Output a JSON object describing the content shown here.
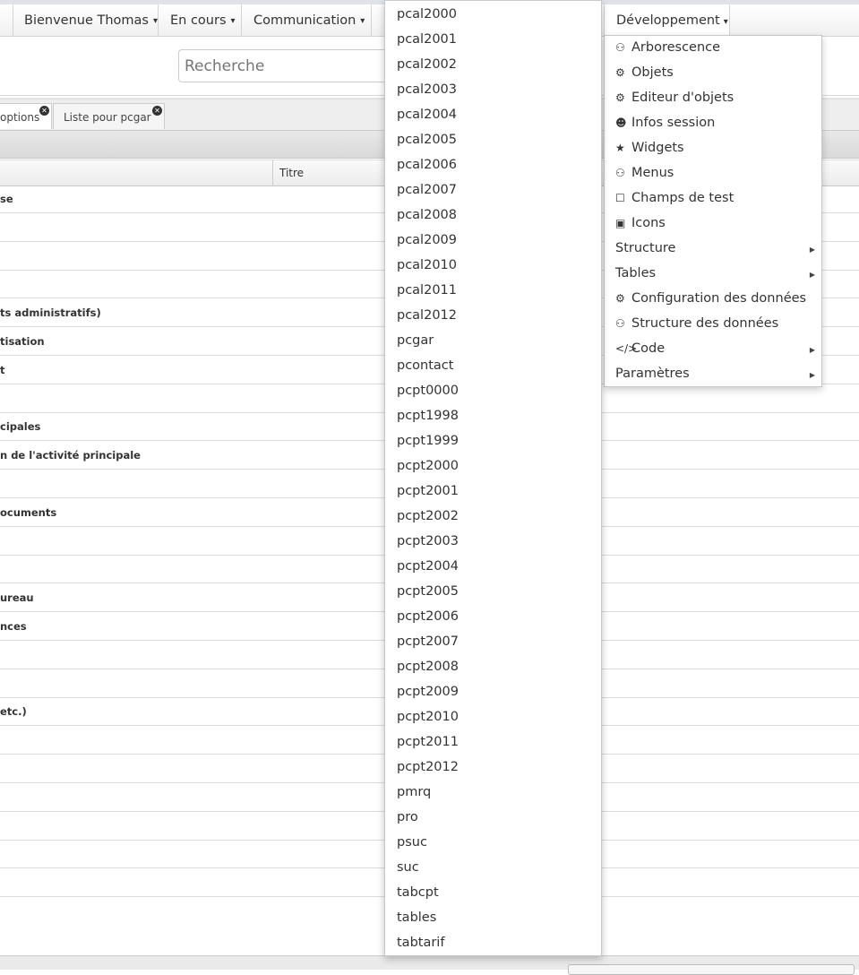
{
  "navbar": {
    "items": [
      {
        "label": "Bienvenue Thomas",
        "caret": "▾"
      },
      {
        "label": "En cours",
        "caret": "▾"
      },
      {
        "label": "Communication",
        "caret": "▾"
      }
    ],
    "dev": {
      "label": "Développement",
      "caret": "▾"
    }
  },
  "search": {
    "placeholder": "Recherche"
  },
  "tabs": [
    {
      "label": "options"
    },
    {
      "label": "Liste pour pcgar"
    }
  ],
  "grid": {
    "col_title": "Titre",
    "rows": [
      "se",
      "",
      "",
      "",
      "ts administratifs)",
      "tisation",
      "t",
      "",
      "cipales",
      "n de l'activité principale",
      "",
      "ocuments",
      "",
      "",
      "ureau",
      "nces",
      "",
      "",
      "etc.)",
      "",
      "",
      "",
      "",
      "",
      ""
    ]
  },
  "table_list": [
    "pcal2000",
    "pcal2001",
    "pcal2002",
    "pcal2003",
    "pcal2004",
    "pcal2005",
    "pcal2006",
    "pcal2007",
    "pcal2008",
    "pcal2009",
    "pcal2010",
    "pcal2011",
    "pcal2012",
    "pcgar",
    "pcontact",
    "pcpt0000",
    "pcpt1998",
    "pcpt1999",
    "pcpt2000",
    "pcpt2001",
    "pcpt2002",
    "pcpt2003",
    "pcpt2004",
    "pcpt2005",
    "pcpt2006",
    "pcpt2007",
    "pcpt2008",
    "pcpt2009",
    "pcpt2010",
    "pcpt2011",
    "pcpt2012",
    "pmrq",
    "pro",
    "psuc",
    "suc",
    "tabcpt",
    "tables",
    "tabtarif"
  ],
  "dev_menu": [
    {
      "label": "Arborescence",
      "icon": "sitemap-icon",
      "glyph": "⚇"
    },
    {
      "label": "Objets",
      "icon": "cogs-icon",
      "glyph": "⚙"
    },
    {
      "label": "Editeur d'objets",
      "icon": "cogs-icon",
      "glyph": "⚙"
    },
    {
      "label": "Infos session",
      "icon": "user-icon",
      "glyph": "☻"
    },
    {
      "label": "Widgets",
      "icon": "star-icon",
      "glyph": "★"
    },
    {
      "label": "Menus",
      "icon": "sitemap-icon",
      "glyph": "⚇"
    },
    {
      "label": "Champs de test",
      "icon": "checkbox-icon",
      "glyph": "☐"
    },
    {
      "label": "Icons",
      "icon": "image-icon",
      "glyph": "▣"
    },
    {
      "label": "Structure",
      "icon": "",
      "glyph": "",
      "submenu": true
    },
    {
      "label": "Tables",
      "icon": "",
      "glyph": "",
      "submenu": true
    },
    {
      "label": "Configuration des données",
      "icon": "cogs-icon",
      "glyph": "⚙"
    },
    {
      "label": "Structure des données",
      "icon": "sitemap-icon",
      "glyph": "⚇"
    },
    {
      "label": "Code",
      "icon": "code-icon",
      "glyph": "</>",
      "submenu": true
    },
    {
      "label": "Paramètres",
      "icon": "",
      "glyph": "",
      "submenu": true
    }
  ]
}
